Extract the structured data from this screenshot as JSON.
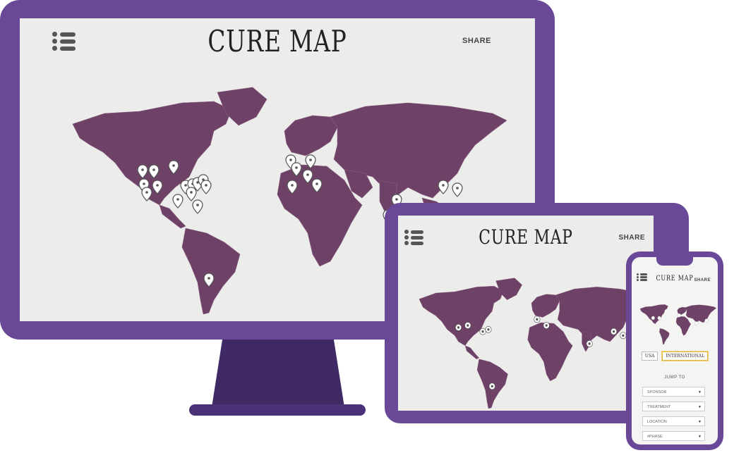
{
  "app": {
    "logo": "CURE MAP",
    "share_label": "SHARE"
  },
  "phone": {
    "toggles": [
      {
        "label": "USA",
        "active": false
      },
      {
        "label": "INTERNATIONAL",
        "active": true
      }
    ],
    "jump_to_label": "JUMP TO",
    "selects": [
      {
        "value": "SPONSOR"
      },
      {
        "value": "TREATMENT"
      },
      {
        "value": "LOCATION"
      },
      {
        "value": "#PHASE"
      }
    ]
  },
  "colors": {
    "device_frame": "#6a4898",
    "land": "#6e4166",
    "screen_bg": "#ececea",
    "pin": "#ffffff",
    "stand": "#3f2a66"
  }
}
